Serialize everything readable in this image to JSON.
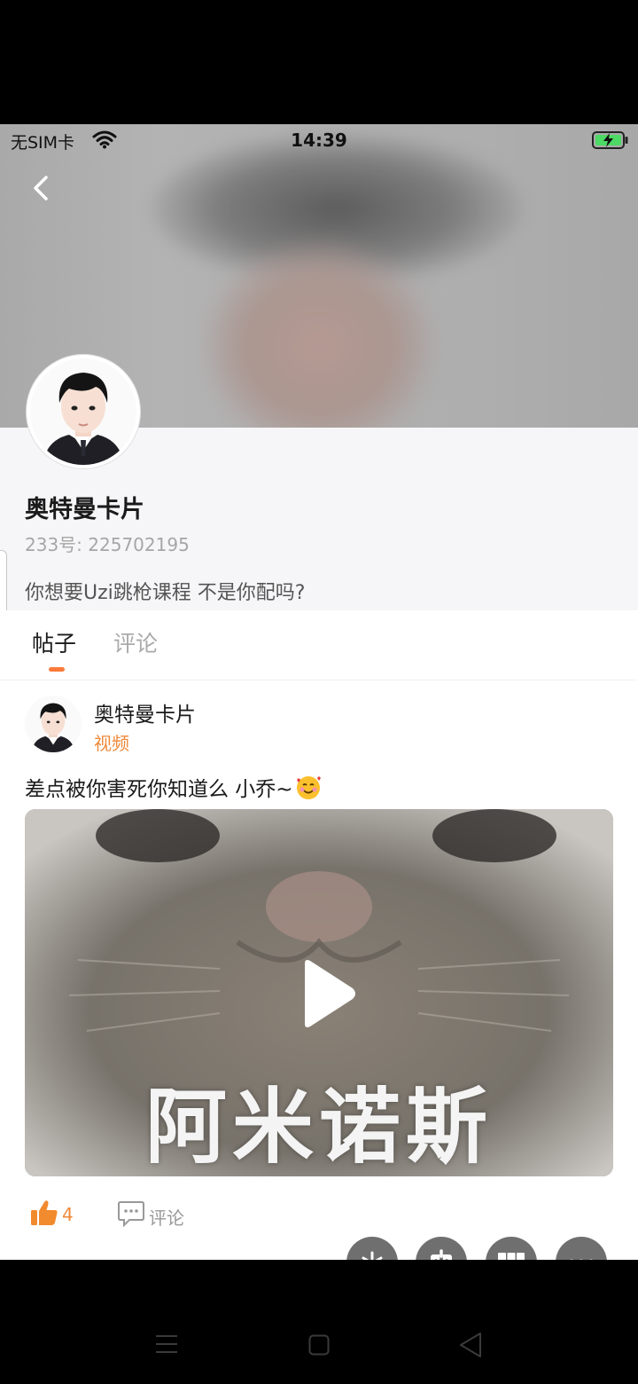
{
  "status_bar": {
    "carrier": "无SIM卡",
    "time": "14:39",
    "icons": [
      "wifi-icon",
      "battery-charging-icon"
    ]
  },
  "header": {
    "back_icon": "chevron-left-icon"
  },
  "profile": {
    "name": "奥特曼卡片",
    "uid_label": "233号:",
    "uid_value": "225702195",
    "bio": "你想要Uzi跳枪课程  不是你配吗?"
  },
  "tabs": [
    {
      "label": "帖子",
      "active": true
    },
    {
      "label": "评论",
      "active": false
    }
  ],
  "post": {
    "author": "奥特曼卡片",
    "type_label": "视频",
    "text": "差点被你害死你知道么 小乔~",
    "emoji": "smiling-face-with-hearts",
    "video_caption": "阿米诺斯",
    "like_count": "4",
    "comment_label": "评论"
  },
  "floating_actions": [
    "speed-icon",
    "download-icon",
    "grid-icon",
    "more-icon"
  ],
  "colors": {
    "accent_orange": "#f0893a",
    "tab_indicator": "#fb7a3a",
    "fab_gray": "#6f6f6f"
  },
  "system_nav": [
    "menu-icon",
    "home-icon",
    "back-triangle-icon"
  ]
}
